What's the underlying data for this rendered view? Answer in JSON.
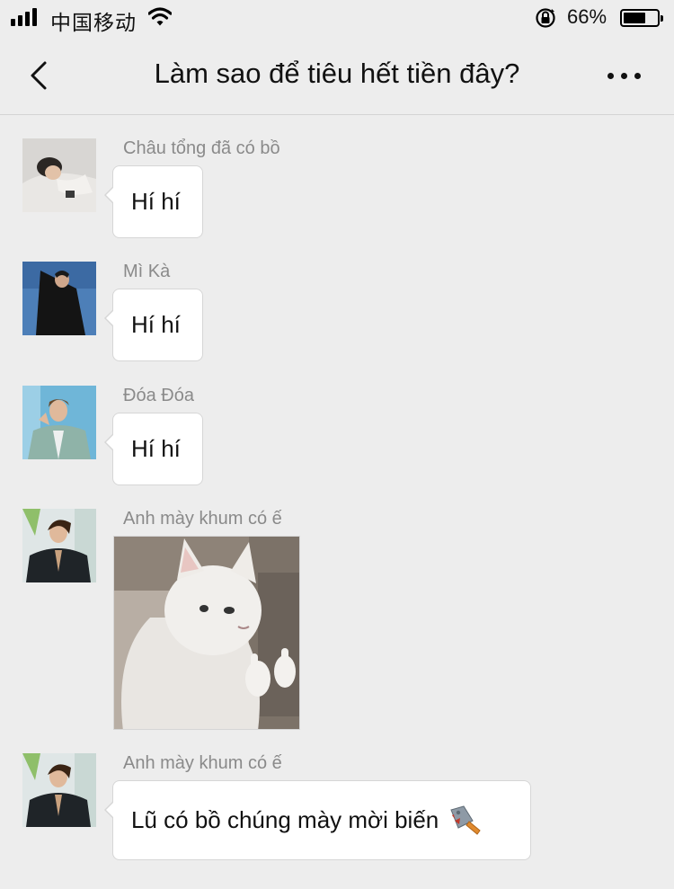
{
  "status_bar": {
    "carrier": "中国移动",
    "battery_percent": "66%",
    "battery_level": 0.66
  },
  "header": {
    "title": "Làm sao để tiêu hết tiền đây?"
  },
  "messages": [
    {
      "sender": "Châu tổng đã có bồ",
      "text": "Hí hí"
    },
    {
      "sender": "Mì Kà",
      "text": "Hí hí"
    },
    {
      "sender": "Đóa Đóa",
      "text": "Hí hí"
    },
    {
      "sender": "Anh mày khum có ế",
      "image": "cat-middle-finger-meme"
    },
    {
      "sender": "Anh mày khum có ế",
      "text": "Lũ có bồ chúng mày mời biến",
      "emoji": "cleaver-knife-icon"
    }
  ],
  "colors": {
    "background": "#ededed",
    "bubble": "#ffffff",
    "sender_text": "#8a8a8a"
  }
}
